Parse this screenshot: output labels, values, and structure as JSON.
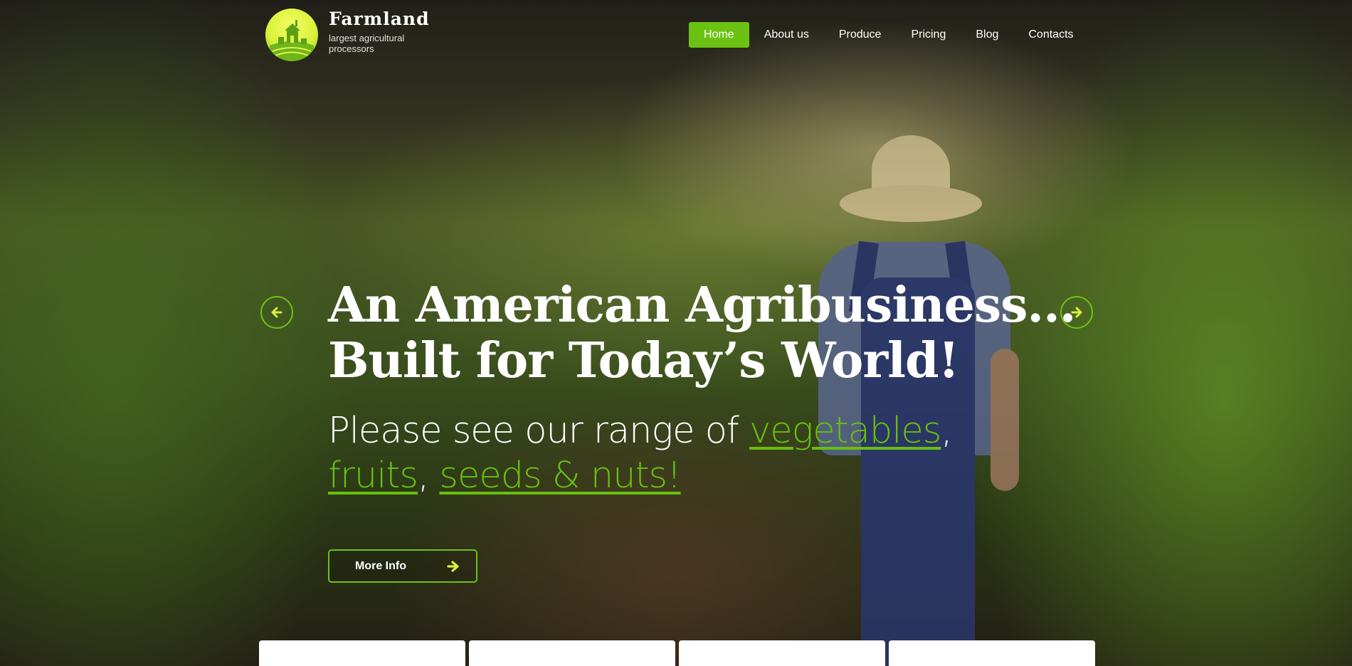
{
  "brand": {
    "name": "Farmland",
    "tagline": "largest agricultural processors",
    "accent_color": "#6cc212",
    "logo_color": "#dff53c"
  },
  "nav": {
    "items": [
      {
        "label": "Home",
        "active": true
      },
      {
        "label": "About us",
        "active": false
      },
      {
        "label": "Produce",
        "active": false
      },
      {
        "label": "Pricing",
        "active": false
      },
      {
        "label": "Blog",
        "active": false
      },
      {
        "label": "Contacts",
        "active": false
      }
    ]
  },
  "hero": {
    "headline_line1": "An American Agribusiness...",
    "headline_line2": "Built for Today’s World!",
    "sub_text": "Please see our range of ",
    "link_vegetables": "vegetables",
    "comma1": ",",
    "link_fruits": "fruits",
    "comma2": ", ",
    "link_seeds": "seeds & nuts!",
    "cta_label": "More Info",
    "prev_icon": "arrow-left-icon",
    "next_icon": "arrow-right-icon"
  },
  "cards": {
    "count_visible": 4
  }
}
